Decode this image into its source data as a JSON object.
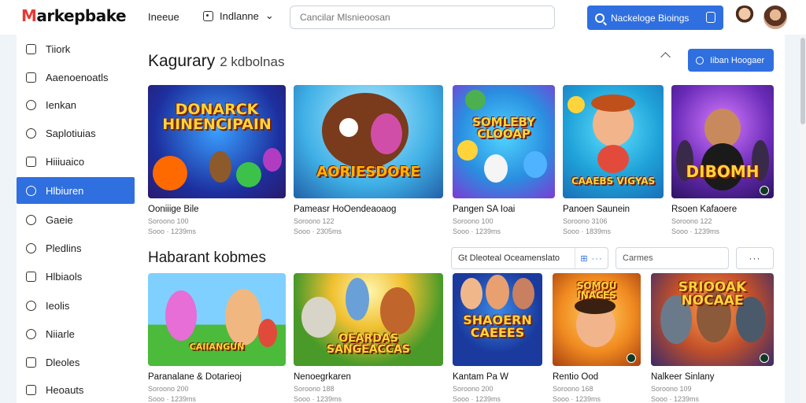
{
  "app": {
    "logo_first": "M",
    "logo_rest": "arkepbake"
  },
  "header": {
    "nav_link": "Ineeue",
    "dropdown_label": "Indlanne",
    "dropdown_caret": "⌄",
    "search_placeholder": "Cancilar Mlsnieoosan",
    "cta_label": "Nackeloge Bioings"
  },
  "sidebar": {
    "items": [
      {
        "label": "Tiiork"
      },
      {
        "label": "Aaenoenoatls"
      },
      {
        "label": "Ienkan"
      },
      {
        "label": "Saplotiuias"
      },
      {
        "label": "Hiiiuaico"
      },
      {
        "label": "Hlbiuren"
      },
      {
        "label": "Gaeie"
      },
      {
        "label": "Pledlins"
      },
      {
        "label": "Hlbiaols"
      },
      {
        "label": "Ieolis"
      },
      {
        "label": "Niiarle"
      },
      {
        "label": "Dleoles"
      },
      {
        "label": "Heoauts"
      }
    ]
  },
  "section1": {
    "title": "Kagurary",
    "subtitle": "2 kdbolnas",
    "button_label": "Iiban Hoogaer",
    "cards": [
      {
        "title": "Ooniiige Bile",
        "meta1": "Soroono 100",
        "meta2": "Sooo · 1239ms",
        "thumb_text": "DONARCK HINENCIPAIN"
      },
      {
        "title": "Pameasr HoOendeaoaog",
        "meta1": "Soroono 122",
        "meta2": "Sooo · 2305ms",
        "thumb_text": "AORIESDORE"
      },
      {
        "title": "Pangen SA Ioai",
        "meta1": "Soroono 100",
        "meta2": "Sooo · 1239ms",
        "thumb_text": "SOMLEBY CLOOAP"
      },
      {
        "title": "Panoen Saunein",
        "meta1": "Soroono 3106",
        "meta2": "Sooo · 1839ms",
        "thumb_text": "CAAEBS VIGYAS"
      },
      {
        "title": "Rsoen Kafaoere",
        "meta1": "Soroono 122",
        "meta2": "Sooo · 1239ms",
        "thumb_text": "DIBOMH"
      }
    ]
  },
  "section2": {
    "title": "Habarant kobmes",
    "filter_label": "Gt Dleoteal Oceamenslato",
    "filter_grid": "⊞ ···",
    "filter_search": "Carmes",
    "filter_more": "···",
    "cards": [
      {
        "title": "Paranalane & Dotarieoj",
        "meta1": "Soroono 200",
        "meta2": "Sooo · 1239ms",
        "thumb_text": "CAIIANGUN"
      },
      {
        "title": "Nenoegrkaren",
        "meta1": "Soroono 188",
        "meta2": "Sooo · 1239ms",
        "thumb_text": "OEARDAS SANGEACCAS"
      },
      {
        "title": "Kantam Pa W",
        "meta1": "Soroono 200",
        "meta2": "Sooo · 1239ms",
        "thumb_text": "SHAOERN CAEEES"
      },
      {
        "title": "Rentio Ood",
        "meta1": "Soroono 168",
        "meta2": "Sooo · 1239ms",
        "thumb_text": "SOMOU INACES"
      },
      {
        "title": "Nalkeer Sinlany",
        "meta1": "Soroono 109",
        "meta2": "Sooo · 1239ms",
        "thumb_text": "SRIOOAK NOCAAE"
      }
    ]
  },
  "colors": {
    "accent": "#2f6fe0",
    "logo_red": "#e53935",
    "page_bg": "#eef4f8"
  }
}
